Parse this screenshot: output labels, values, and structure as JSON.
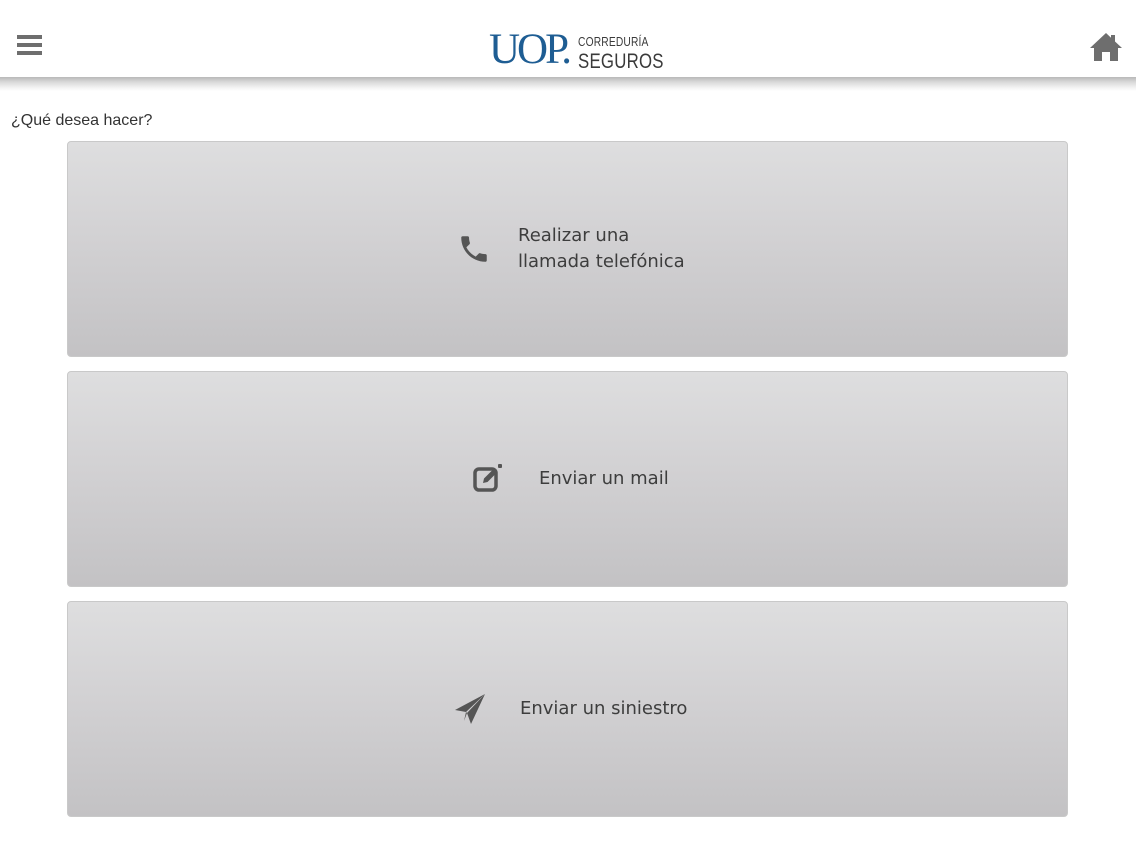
{
  "header": {
    "logo": {
      "mark": "UOP.",
      "line1": "CORREDURÍA",
      "line2": "SEGUROS"
    },
    "menu_icon": "hamburger-menu-icon",
    "home_icon": "home-icon"
  },
  "main": {
    "prompt": "¿Qué desea hacer?",
    "actions": [
      {
        "label": "Realizar una\nllamada telefónica",
        "icon": "phone-icon"
      },
      {
        "label": "Enviar un mail",
        "icon": "edit-mail-icon"
      },
      {
        "label": "Enviar un siniestro",
        "icon": "paper-plane-icon"
      }
    ]
  },
  "colors": {
    "brand_blue": "#1e5d93",
    "icon_gray": "#6e6e6e",
    "text": "#3d3d3d"
  }
}
